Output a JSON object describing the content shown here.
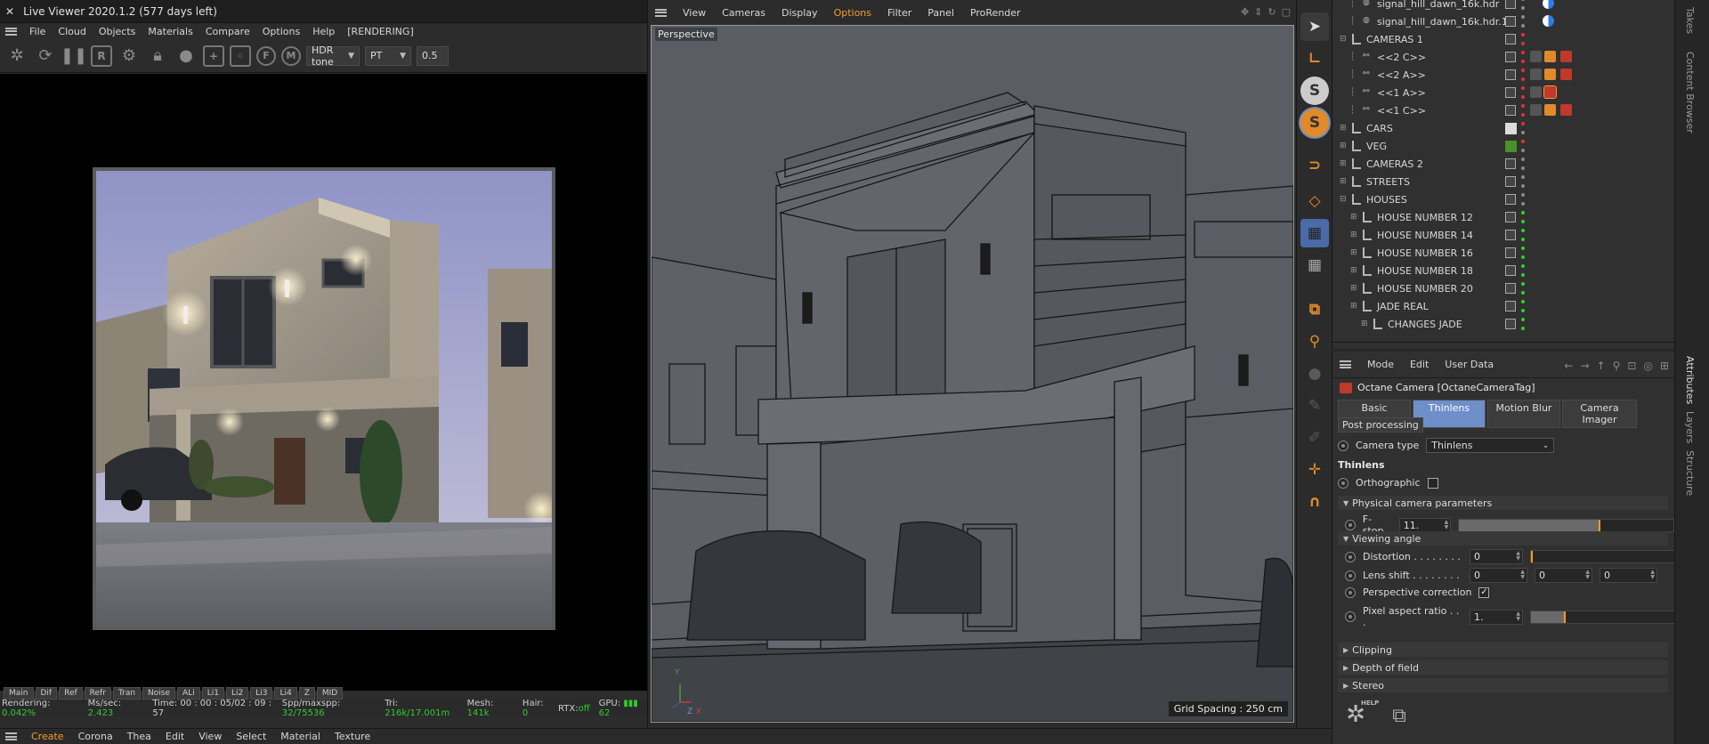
{
  "live_viewer": {
    "title": "Live Viewer 2020.1.2 (577 days left)",
    "menu": [
      "File",
      "Cloud",
      "Objects",
      "Materials",
      "Compare",
      "Options",
      "Help",
      "[RENDERING]"
    ],
    "tone_mode": "HDR tone",
    "kernel": "PT",
    "tone_value": "0.5",
    "passes": [
      "Main",
      "Dif",
      "Ref",
      "Refr",
      "Tran",
      "Noise",
      "ALi",
      "Li1",
      "Li2",
      "Li3",
      "Li4",
      "Z",
      "MID"
    ],
    "status": {
      "rendering_label": "Rendering:",
      "rendering_value": "0.042%",
      "ms_label": "Ms/sec:",
      "ms_value": "2.423",
      "time_label": "Time:",
      "time_value": "00 : 00 : 05/02 : 09 : 57",
      "spp_label": "Spp/maxspp:",
      "spp_value": "32/75536",
      "tri_label": "Tri:",
      "tri_value": "216k/17.001m",
      "mesh_label": "Mesh:",
      "mesh_value": "141k",
      "hair_label": "Hair:",
      "hair_value": "0",
      "rtx_label": "RTX:",
      "rtx_value": "off",
      "gpu_label": "GPU:",
      "gpu_value": "62"
    }
  },
  "viewport": {
    "menu": [
      "View",
      "Cameras",
      "Display",
      "Options",
      "Filter",
      "Panel",
      "ProRender"
    ],
    "active_menu": "Options",
    "label": "Perspective",
    "grid_spacing": "Grid Spacing : 250 cm",
    "axis_y": "Y",
    "axis_z": "Z",
    "axis_x": "X"
  },
  "bottom_bar": {
    "items": [
      "Create",
      "Corona",
      "Thea",
      "Edit",
      "View",
      "Select",
      "Material",
      "Texture"
    ]
  },
  "object_manager": {
    "rows": [
      {
        "name": "signal_hill_dawn_16k.hdr",
        "indent": 1,
        "kind": "sky"
      },
      {
        "name": "signal_hill_dawn_16k.hdr.1",
        "indent": 1,
        "kind": "sky"
      },
      {
        "name": "CAMERAS 1",
        "indent": 0,
        "kind": "layer",
        "expanded": true
      },
      {
        "name": "<<2 C>>",
        "indent": 1,
        "kind": "cam"
      },
      {
        "name": "<<2 A>>",
        "indent": 1,
        "kind": "cam"
      },
      {
        "name": "<<1 A>>",
        "indent": 1,
        "kind": "cam"
      },
      {
        "name": "<<1 C>>",
        "indent": 1,
        "kind": "cam"
      },
      {
        "name": "CARS",
        "indent": 0,
        "kind": "layer"
      },
      {
        "name": "VEG",
        "indent": 0,
        "kind": "layer"
      },
      {
        "name": "CAMERAS 2",
        "indent": 0,
        "kind": "layer"
      },
      {
        "name": "STREETS",
        "indent": 0,
        "kind": "layer"
      },
      {
        "name": "HOUSES",
        "indent": 0,
        "kind": "layer",
        "expanded": true
      },
      {
        "name": "HOUSE NUMBER 12",
        "indent": 1,
        "kind": "layer"
      },
      {
        "name": "HOUSE NUMBER 14",
        "indent": 1,
        "kind": "layer"
      },
      {
        "name": "HOUSE NUMBER 16",
        "indent": 1,
        "kind": "layer"
      },
      {
        "name": "HOUSE NUMBER 18",
        "indent": 1,
        "kind": "layer"
      },
      {
        "name": "HOUSE NUMBER 20",
        "indent": 1,
        "kind": "layer"
      },
      {
        "name": "JADE REAL",
        "indent": 1,
        "kind": "layer"
      },
      {
        "name": "CHANGES JADE",
        "indent": 2,
        "kind": "layer"
      }
    ]
  },
  "attributes": {
    "menu": [
      "Mode",
      "Edit",
      "User Data"
    ],
    "header": "Octane Camera [OctaneCameraTag]",
    "tabs": [
      "Basic",
      "Thinlens",
      "Motion Blur",
      "Camera Imager"
    ],
    "active_tab": "Thinlens",
    "tab2": "Post processing",
    "camera_type_label": "Camera type",
    "camera_type_value": "Thinlens",
    "section_title": "Thinlens",
    "orthographic_label": "Orthographic",
    "orthographic_checked": false,
    "group_physical": "Physical camera parameters",
    "fstop_label": "F-stop",
    "fstop_value": "11.",
    "fstop_slider": 0.65,
    "group_viewing": "Viewing angle",
    "distortion_label": "Distortion . . . . . . . .",
    "distortion_value": "0",
    "lens_shift_label": "Lens shift . . . . . . . .",
    "lens_shift_values": [
      "0",
      "0",
      "0"
    ],
    "persp_corr_label": "Perspective correction",
    "persp_corr_checked": true,
    "par_label": "Pixel aspect ratio . . .",
    "par_value": "1.",
    "par_slider": 0.22,
    "group_clipping": "Clipping",
    "group_dof": "Depth of field",
    "group_stereo": "Stereo"
  },
  "right_tabs": [
    "Takes",
    "Content Browser",
    "Attributes",
    "Layers",
    "Structure"
  ],
  "tools_help": "HELP"
}
